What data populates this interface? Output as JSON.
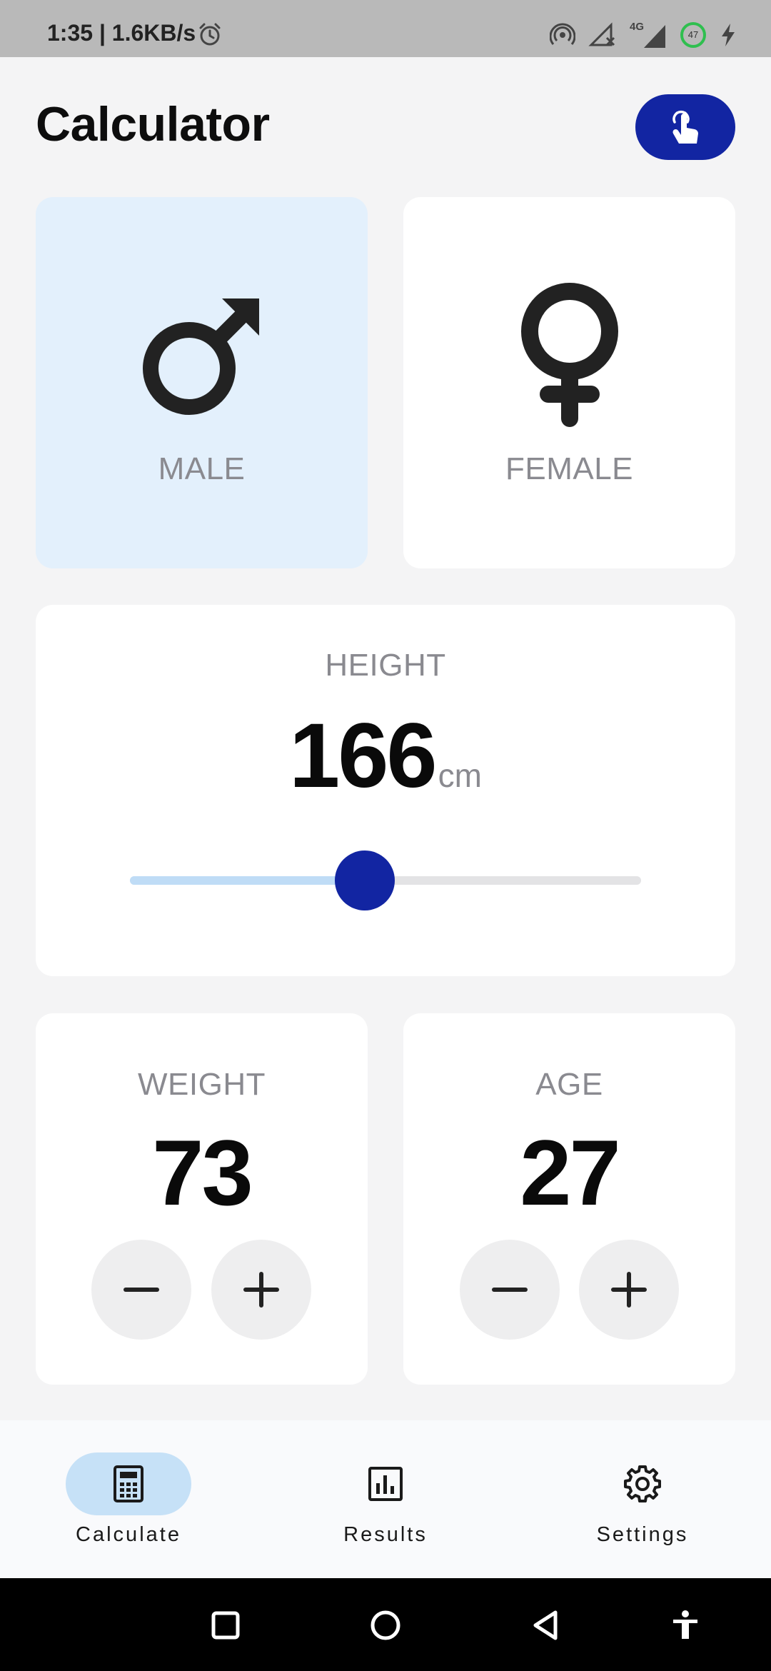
{
  "status_bar": {
    "time_speed": "1:35 | 1.6KB/s",
    "network_label": "4G",
    "battery_level": "47"
  },
  "header": {
    "title": "Calculator",
    "action_icon": "touch-gesture-icon"
  },
  "gender": {
    "male_label": "MALE",
    "female_label": "FEMALE",
    "selected": "male"
  },
  "height": {
    "label": "HEIGHT",
    "value": "166",
    "unit": "cm",
    "slider_fraction": 0.46
  },
  "weight": {
    "label": "WEIGHT",
    "value": "73"
  },
  "age": {
    "label": "AGE",
    "value": "27"
  },
  "bottom_nav": {
    "items": [
      {
        "label": "Calculate",
        "icon": "calculator-icon",
        "active": true
      },
      {
        "label": "Results",
        "icon": "bar-chart-icon",
        "active": false
      },
      {
        "label": "Settings",
        "icon": "gear-icon",
        "active": false
      }
    ]
  },
  "colors": {
    "accent": "#1225a2",
    "selected_card": "#e3f0fc",
    "slider_fill": "#bfdcf6",
    "active_nav_pill": "#c6e1f7"
  }
}
